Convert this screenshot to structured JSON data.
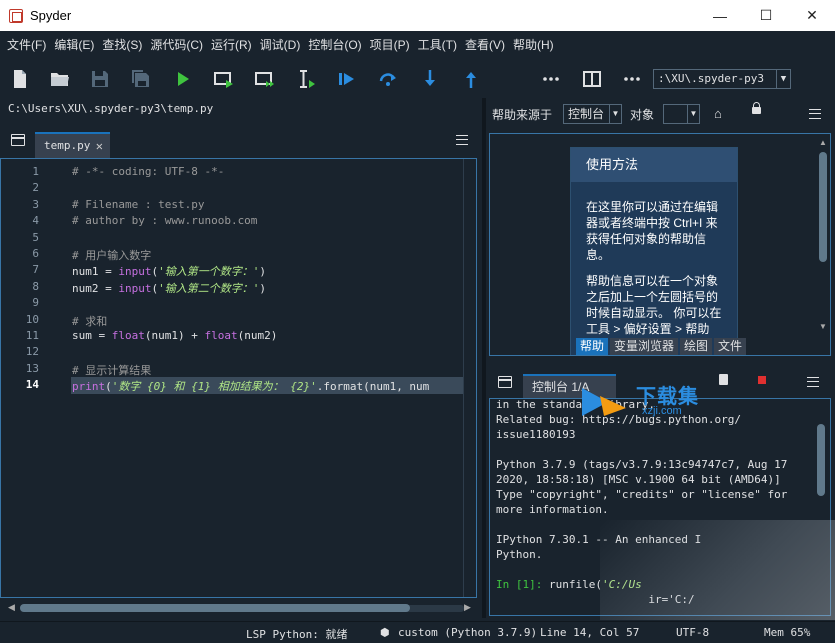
{
  "window": {
    "title": "Spyder",
    "minimize": "—",
    "maximize": "☐",
    "close": "✕"
  },
  "menu": [
    "文件(F)",
    "编辑(E)",
    "查找(S)",
    "源代码(C)",
    "运行(R)",
    "调试(D)",
    "控制台(O)",
    "项目(P)",
    "工具(T)",
    "查看(V)",
    "帮助(H)"
  ],
  "toolbar": {
    "icons": [
      "new-file-icon",
      "open-file-icon",
      "save-icon",
      "save-all-icon",
      "run-icon",
      "run-cell-icon",
      "run-cell-advance-icon",
      "run-selection-icon",
      "debug-icon",
      "step-over-icon",
      "step-into-icon",
      "step-return-icon",
      "more-icon",
      "maximize-pane-icon",
      "more-icon"
    ],
    "working_dir": ":\\XU\\.spyder-py3",
    "accent": "#1a72bb",
    "run_color": "#3fc33f"
  },
  "editor": {
    "file_path": "C:\\Users\\XU\\.spyder-py3\\temp.py",
    "tab_label": "temp.py",
    "tab_close": "✕",
    "active_line": 14,
    "lines": [
      {
        "n": "1",
        "parts": [
          {
            "t": "# -*- coding: UTF-8 -*-",
            "c": "cm"
          }
        ]
      },
      {
        "n": "2",
        "parts": []
      },
      {
        "n": "3",
        "parts": [
          {
            "t": "# Filename : test.py",
            "c": "cm"
          }
        ]
      },
      {
        "n": "4",
        "parts": [
          {
            "t": "# author by : www.runoob.com",
            "c": "cm"
          }
        ]
      },
      {
        "n": "5",
        "parts": []
      },
      {
        "n": "6",
        "parts": [
          {
            "t": "# 用户输入数字",
            "c": "cm"
          }
        ]
      },
      {
        "n": "7",
        "parts": [
          {
            "t": "num1 = ",
            "c": ""
          },
          {
            "t": "input",
            "c": "fn"
          },
          {
            "t": "(",
            "c": ""
          },
          {
            "t": "'输入第一个数字：'",
            "c": "str"
          },
          {
            "t": ")",
            "c": ""
          }
        ]
      },
      {
        "n": "8",
        "parts": [
          {
            "t": "num2 = ",
            "c": ""
          },
          {
            "t": "input",
            "c": "fn"
          },
          {
            "t": "(",
            "c": ""
          },
          {
            "t": "'输入第二个数字：'",
            "c": "str"
          },
          {
            "t": ")",
            "c": ""
          }
        ]
      },
      {
        "n": "9",
        "parts": []
      },
      {
        "n": "10",
        "parts": [
          {
            "t": "# 求和",
            "c": "cm"
          }
        ]
      },
      {
        "n": "11",
        "parts": [
          {
            "t": "sum = ",
            "c": ""
          },
          {
            "t": "float",
            "c": "fn"
          },
          {
            "t": "(num1) + ",
            "c": ""
          },
          {
            "t": "float",
            "c": "fn"
          },
          {
            "t": "(num2)",
            "c": ""
          }
        ]
      },
      {
        "n": "12",
        "parts": []
      },
      {
        "n": "13",
        "parts": [
          {
            "t": "# 显示计算结果",
            "c": "cm"
          }
        ]
      },
      {
        "n": "14",
        "parts": [
          {
            "t": "print",
            "c": "fn"
          },
          {
            "t": "(",
            "c": ""
          },
          {
            "t": "'数字 {0} 和 {1} 相加结果为： {2}'",
            "c": "str"
          },
          {
            "t": ".format(num1, num",
            "c": ""
          }
        ]
      }
    ]
  },
  "help": {
    "source_label": "帮助来源于",
    "source_value": "控制台",
    "object_label": "对象",
    "object_value": "",
    "card_title": "使用方法",
    "card_para1": "在这里你可以通过在编辑器或者终端中按 Ctrl+I 来获得任何对象的帮助信息。",
    "card_para2": "帮助信息可以在一个对象之后加上一个左圆括号的时候自动显示。 你可以在 工具 > 偏好设置 > 帮助",
    "tabs": [
      "帮助",
      "变量浏览器",
      "绘图",
      "文件"
    ],
    "active_tab": 0
  },
  "console": {
    "tab_label": "控制台 1/A",
    "lines": [
      "in the standard library.",
      "Related bug: https://bugs.python.org/",
      "issue1180193",
      "",
      "Python 3.7.9 (tags/v3.7.9:13c94747c7, Aug 17",
      "2020, 18:58:18) [MSC v.1900 64 bit (AMD64)]",
      "Type \"copyright\", \"credits\" or \"license\" for",
      "more information.",
      "",
      "IPython 7.30.1 -- An enhanced I",
      "Python.",
      ""
    ],
    "prompt": "In [1]:",
    "command": " runfile(",
    "command_arg": "'C:/Us",
    "last_line": "                       ir='C:/"
  },
  "watermark": {
    "text": "下载集",
    "sub": "xzji.com"
  },
  "status": {
    "lsp": "LSP Python: 就绪",
    "env": "custom (Python 3.7.9)",
    "position": "Line 14, Col 57",
    "encoding": "UTF-8",
    "mem": "Mem 65%"
  }
}
